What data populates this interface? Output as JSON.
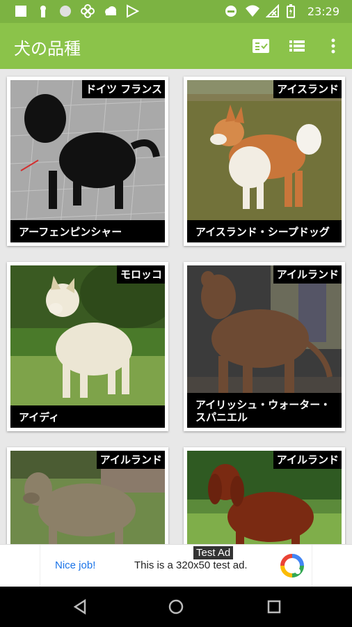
{
  "status_bar": {
    "time": "23:29",
    "left_icons": [
      "square-icon",
      "keyhole-icon",
      "circle-icon",
      "fan-icon",
      "cloud-icon",
      "play-store-icon"
    ],
    "right_icons": [
      "do-not-disturb-icon",
      "wifi-icon",
      "signal-icon",
      "battery-icon"
    ]
  },
  "app_bar": {
    "title": "犬の品種",
    "actions": [
      "checklist-icon",
      "list-view-icon",
      "more-vert-icon"
    ]
  },
  "breeds": [
    {
      "country": "ドイツ フランス",
      "name": "アーフェンピンシャー"
    },
    {
      "country": "アイスランド",
      "name": "アイスランド・シープドッグ"
    },
    {
      "country": "モロッコ",
      "name": "アイディ"
    },
    {
      "country": "アイルランド",
      "name": "アイリッシュ・ウォーター・スパニエル"
    },
    {
      "country": "アイルランド",
      "name": ""
    },
    {
      "country": "アイルランド",
      "name": ""
    }
  ],
  "ad": {
    "tag": "Test Ad",
    "nice": "Nice job!",
    "description": "This is a 320x50 test ad."
  },
  "nav_bar": {
    "buttons": [
      "back-icon",
      "home-icon",
      "recents-icon"
    ]
  },
  "colors": {
    "status_bar": "#7cb342",
    "app_bar": "#8bc34a",
    "ad_link": "#1a73e8"
  }
}
